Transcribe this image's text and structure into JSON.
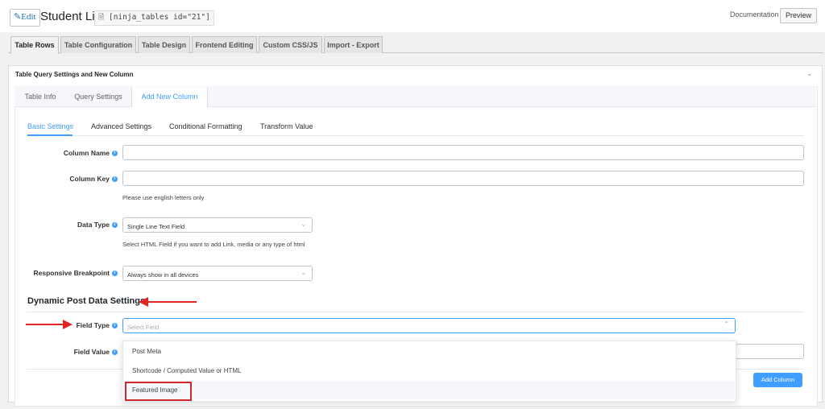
{
  "header": {
    "edit_label": "Edit",
    "title": "Student List",
    "shortcode": "[ninja_tables id=\"21\"]",
    "documentation": "Documentation",
    "preview": "Preview"
  },
  "main_tabs": [
    {
      "label": "Table Rows",
      "active": true
    },
    {
      "label": "Table Configuration"
    },
    {
      "label": "Table Design"
    },
    {
      "label": "Frontend Editing"
    },
    {
      "label": "Custom CSS/JS"
    },
    {
      "label": "Import - Export"
    }
  ],
  "panel": {
    "title": "Table Query Settings and New Column",
    "inner_tabs": [
      {
        "label": "Table Info"
      },
      {
        "label": "Query Settings"
      },
      {
        "label": "Add New Column",
        "active": true
      }
    ],
    "sub_tabs": [
      {
        "label": "Basic Settings",
        "active": true
      },
      {
        "label": "Advanced Settings"
      },
      {
        "label": "Conditional Formatting"
      },
      {
        "label": "Transform Value"
      }
    ]
  },
  "form": {
    "column_name_label": "Column Name",
    "column_name_value": "",
    "column_key_label": "Column Key",
    "column_key_value": "",
    "column_key_help": "Please use english letters only",
    "data_type_label": "Data Type",
    "data_type_value": "Single Line Text Field",
    "data_type_help": "Select HTML Field if you want to add Link, media or any type of html",
    "breakpoint_label": "Responsive Breakpoint",
    "breakpoint_value": "Always show in all devices",
    "dynamic_heading": "Dynamic Post Data Settings",
    "field_type_label": "Field Type",
    "field_type_placeholder": "Select Field",
    "field_value_label": "Field Value",
    "field_type_options": [
      "Post Meta",
      "Shortcode / Computed Value or HTML",
      "Featured Image"
    ],
    "add_column_button": "Add Column"
  },
  "colors": {
    "accent": "#409eff",
    "annotation_red": "#d1262b"
  },
  "icons": {
    "edit": "pencil-icon",
    "shortcode": "document-icon",
    "info": "info-circle-icon",
    "chevron": "chevron-down-icon"
  }
}
